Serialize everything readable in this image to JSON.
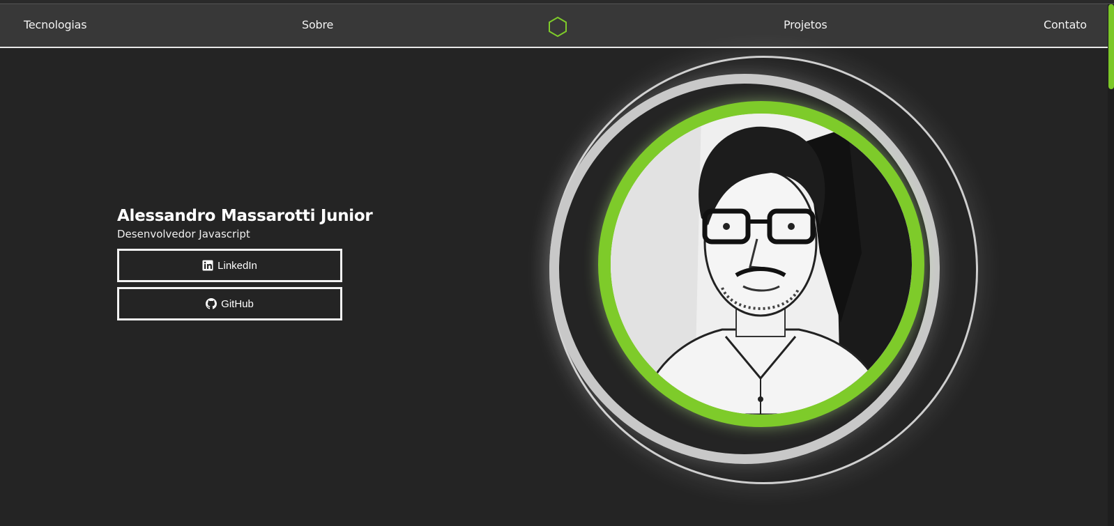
{
  "nav": {
    "items": [
      "Tecnologias",
      "Sobre",
      "Projetos",
      "Contato"
    ],
    "logo_icon": "hexagon-icon"
  },
  "hero": {
    "name": "Alessandro Massarotti Junior",
    "role": "Desenvolvedor Javascript",
    "buttons": {
      "linkedin": {
        "label": "LinkedIn",
        "icon": "linkedin-icon"
      },
      "github": {
        "label": "GitHub",
        "icon": "github-icon"
      }
    }
  },
  "colors": {
    "background": "#242424",
    "navbar": "#383838",
    "accent": "#7ecb2a",
    "ring": "#c8c8c8"
  }
}
